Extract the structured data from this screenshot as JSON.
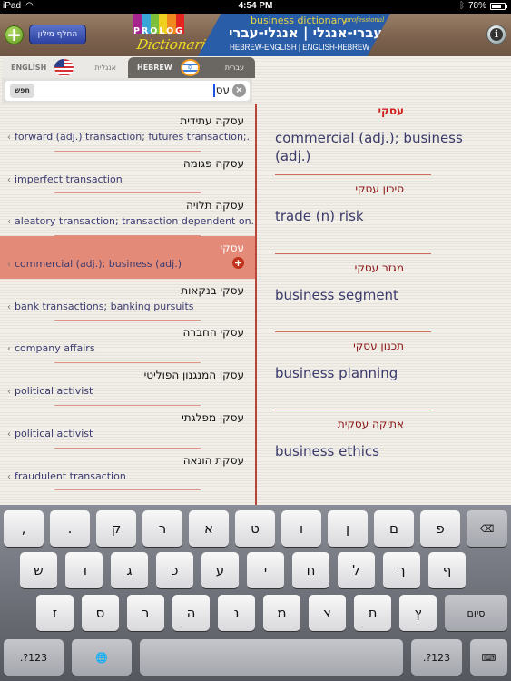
{
  "status_bar": {
    "device": "iPad",
    "time": "4:54 PM",
    "battery": "78%",
    "battery_level": 0.78
  },
  "header": {
    "switch_dictionary_label": "החלף מילון",
    "logo_top": "PROLOG",
    "logo_bottom": "Dictionaries",
    "logo_colors": [
      "#a7238e",
      "#3aa6d8",
      "#7cbf3a",
      "#f0d020",
      "#f08a1e",
      "#e0261f"
    ],
    "banner_subtitle": "business dictionary",
    "banner_edition": "professional",
    "banner_hebrew": "עברי-אנגלי | אנגלי-עברי",
    "banner_english": "HEBREW-ENGLISH | ENGLISH-HEBREW",
    "info_label": "i",
    "add_label": "+"
  },
  "tabs": {
    "english_label": "ENGLISH",
    "english_hebrew_label": "אנגלית",
    "hebrew_label": "HEBREW",
    "hebrew_hebrew_label": "עברית",
    "active": "hebrew"
  },
  "search": {
    "button_label": "חפש",
    "value": "עס"
  },
  "results": [
    {
      "hebrew": "עסקה עתידית",
      "english": "forward (adj.) transaction; futures transaction;."
    },
    {
      "hebrew": "עסקה פגומה",
      "english": "imperfect transaction"
    },
    {
      "hebrew": "עסקה תלויה",
      "english": "aleatory transaction; transaction dependent on."
    },
    {
      "hebrew": "עסקי",
      "english": "commercial (adj.); business (adj.)",
      "selected": true
    },
    {
      "hebrew": "עסקי בנקאות",
      "english": "bank transactions; banking pursuits"
    },
    {
      "hebrew": "עסקי החברה",
      "english": "company affairs"
    },
    {
      "hebrew": "עסקן המנגנון הפוליטי",
      "english": "political activist"
    },
    {
      "hebrew": "עסקן מפלגתי",
      "english": "political activist"
    },
    {
      "hebrew": "עסקת הונאה",
      "english": "fraudulent transaction"
    }
  ],
  "detail": [
    {
      "term": "עסקי",
      "definition": "commercial (adj.); business (adj.)"
    },
    {
      "term": "סיכון עסקי",
      "definition": "trade (n) risk"
    },
    {
      "term": "מגזר עסקי",
      "definition": "business segment"
    },
    {
      "term": "תכנון עסקי",
      "definition": "business planning"
    },
    {
      "term": "אתיקה עסקית",
      "definition": "business ethics"
    }
  ],
  "keyboard": {
    "row1": [
      ",",
      ".",
      "ק",
      "ר",
      "א",
      "ט",
      "ו",
      "ן",
      "ם",
      "פ"
    ],
    "row2": [
      "ש",
      "ד",
      "ג",
      "כ",
      "ע",
      "י",
      "ח",
      "ל",
      "ך",
      "ף"
    ],
    "row3": [
      "ז",
      "ס",
      "ב",
      "ה",
      "נ",
      "מ",
      "צ",
      "ת",
      "ץ"
    ],
    "done_label": "סיום",
    "numbers_label": ".?123",
    "globe_icon": "🌐",
    "backspace_icon": "⌫",
    "hide_keyboard_icon": "⌨"
  }
}
